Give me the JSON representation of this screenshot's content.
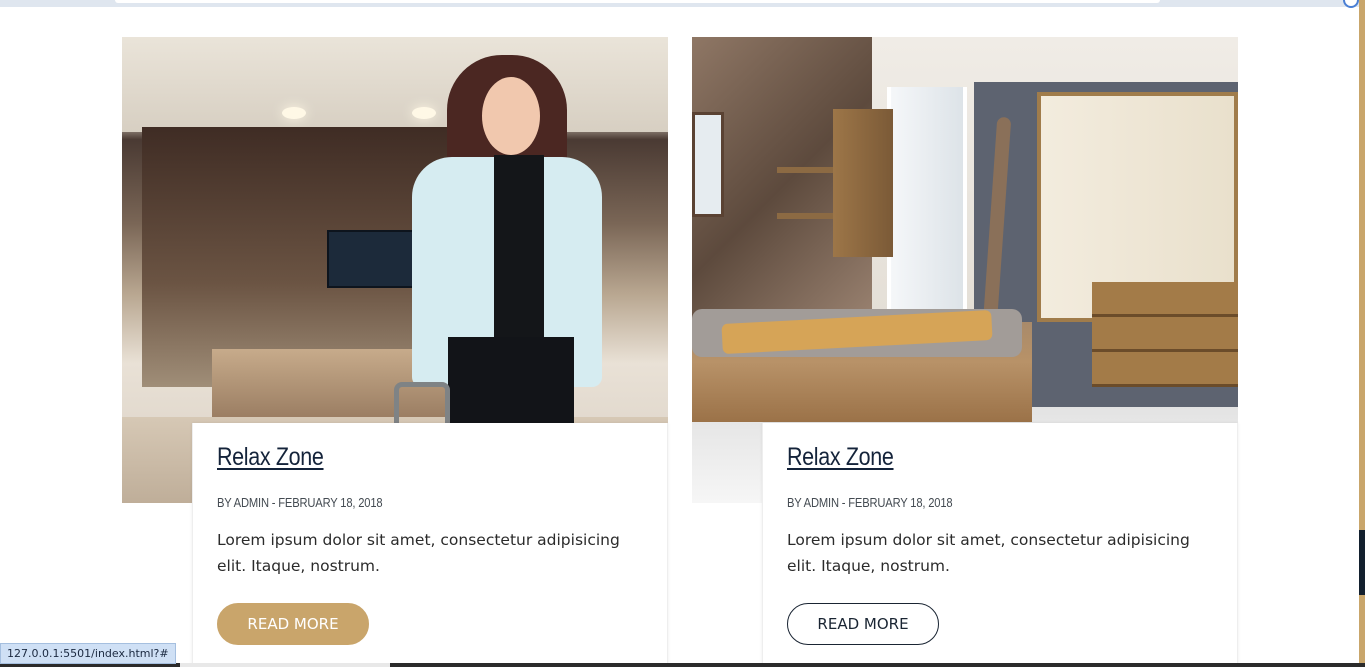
{
  "browser": {
    "status_url": "127.0.0.1:5501/index.html?#"
  },
  "theme": {
    "accent": "#c9a56b",
    "dark": "#14233a"
  },
  "posts": [
    {
      "title": "Relax Zone",
      "meta": "BY ADMIN - FEBRUARY 18, 2018",
      "excerpt": "Lorem ipsum dolor sit amet, consectetur adipisicing elit. Itaque, nostrum.",
      "button_label": "READ MORE",
      "button_style": "filled"
    },
    {
      "title": "Relax Zone",
      "meta": "BY ADMIN - FEBRUARY 18, 2018",
      "excerpt": "Lorem ipsum dolor sit amet, consectetur adipisicing elit. Itaque, nostrum.",
      "button_label": "READ MORE",
      "button_style": "outline"
    }
  ]
}
